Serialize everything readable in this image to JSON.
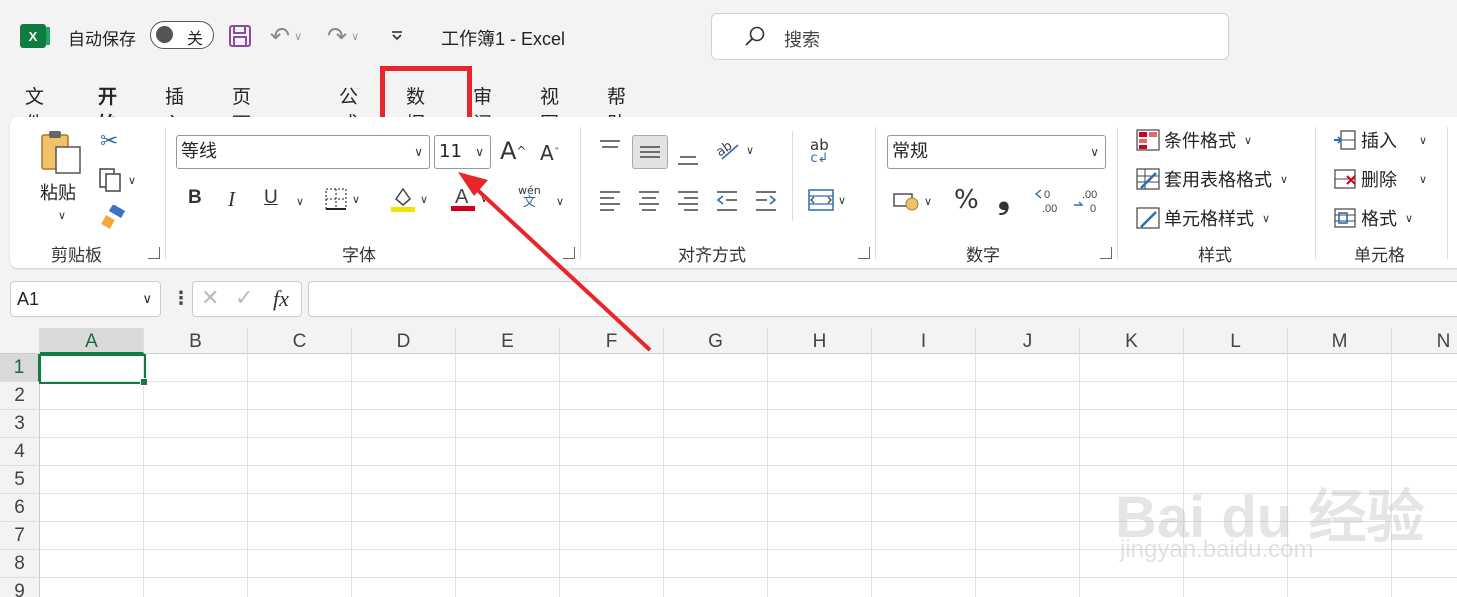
{
  "titlebar": {
    "autosave_label": "自动保存",
    "autosave_state": "关",
    "doc_title": "工作簿1  -  Excel",
    "search_placeholder": "搜索"
  },
  "tabs": [
    "文件",
    "开始",
    "插入",
    "页面布局",
    "公式",
    "数据",
    "审阅",
    "视图",
    "帮助"
  ],
  "active_tab": "开始",
  "highlighted_tab": "数据",
  "ribbon": {
    "clipboard": {
      "paste_label": "粘贴",
      "group_label": "剪贴板"
    },
    "font": {
      "font_name": "等线",
      "font_size": "11",
      "group_label": "字体",
      "bold": "B",
      "italic": "I",
      "underline": "U",
      "phonetic": "wén",
      "phonetic_char": "文",
      "grow": "A",
      "shrink": "A"
    },
    "alignment": {
      "group_label": "对齐方式",
      "wrap": "ab"
    },
    "number": {
      "format": "常规",
      "group_label": "数字",
      "percent": "%",
      "comma": "❟"
    },
    "styles": {
      "conditional": "条件格式",
      "table": "套用表格格式",
      "cell": "单元格样式",
      "group_label": "样式"
    },
    "cells": {
      "insert": "插入",
      "delete": "删除",
      "format": "格式",
      "group_label": "单元格"
    }
  },
  "formula_bar": {
    "name_box": "A1",
    "fx": "fx"
  },
  "grid": {
    "columns": [
      "A",
      "B",
      "C",
      "D",
      "E",
      "F",
      "G",
      "H",
      "I",
      "J",
      "K",
      "L",
      "M",
      "N"
    ],
    "rows": [
      "1",
      "2",
      "3",
      "4",
      "5",
      "6",
      "7",
      "8",
      "9"
    ],
    "selected_cell": "A1"
  },
  "watermark": {
    "main": "Bai du 经验",
    "sub": "jingyan.baidu.com"
  },
  "colors": {
    "excel_green": "#107c41",
    "highlight_red": "#e8252a"
  }
}
